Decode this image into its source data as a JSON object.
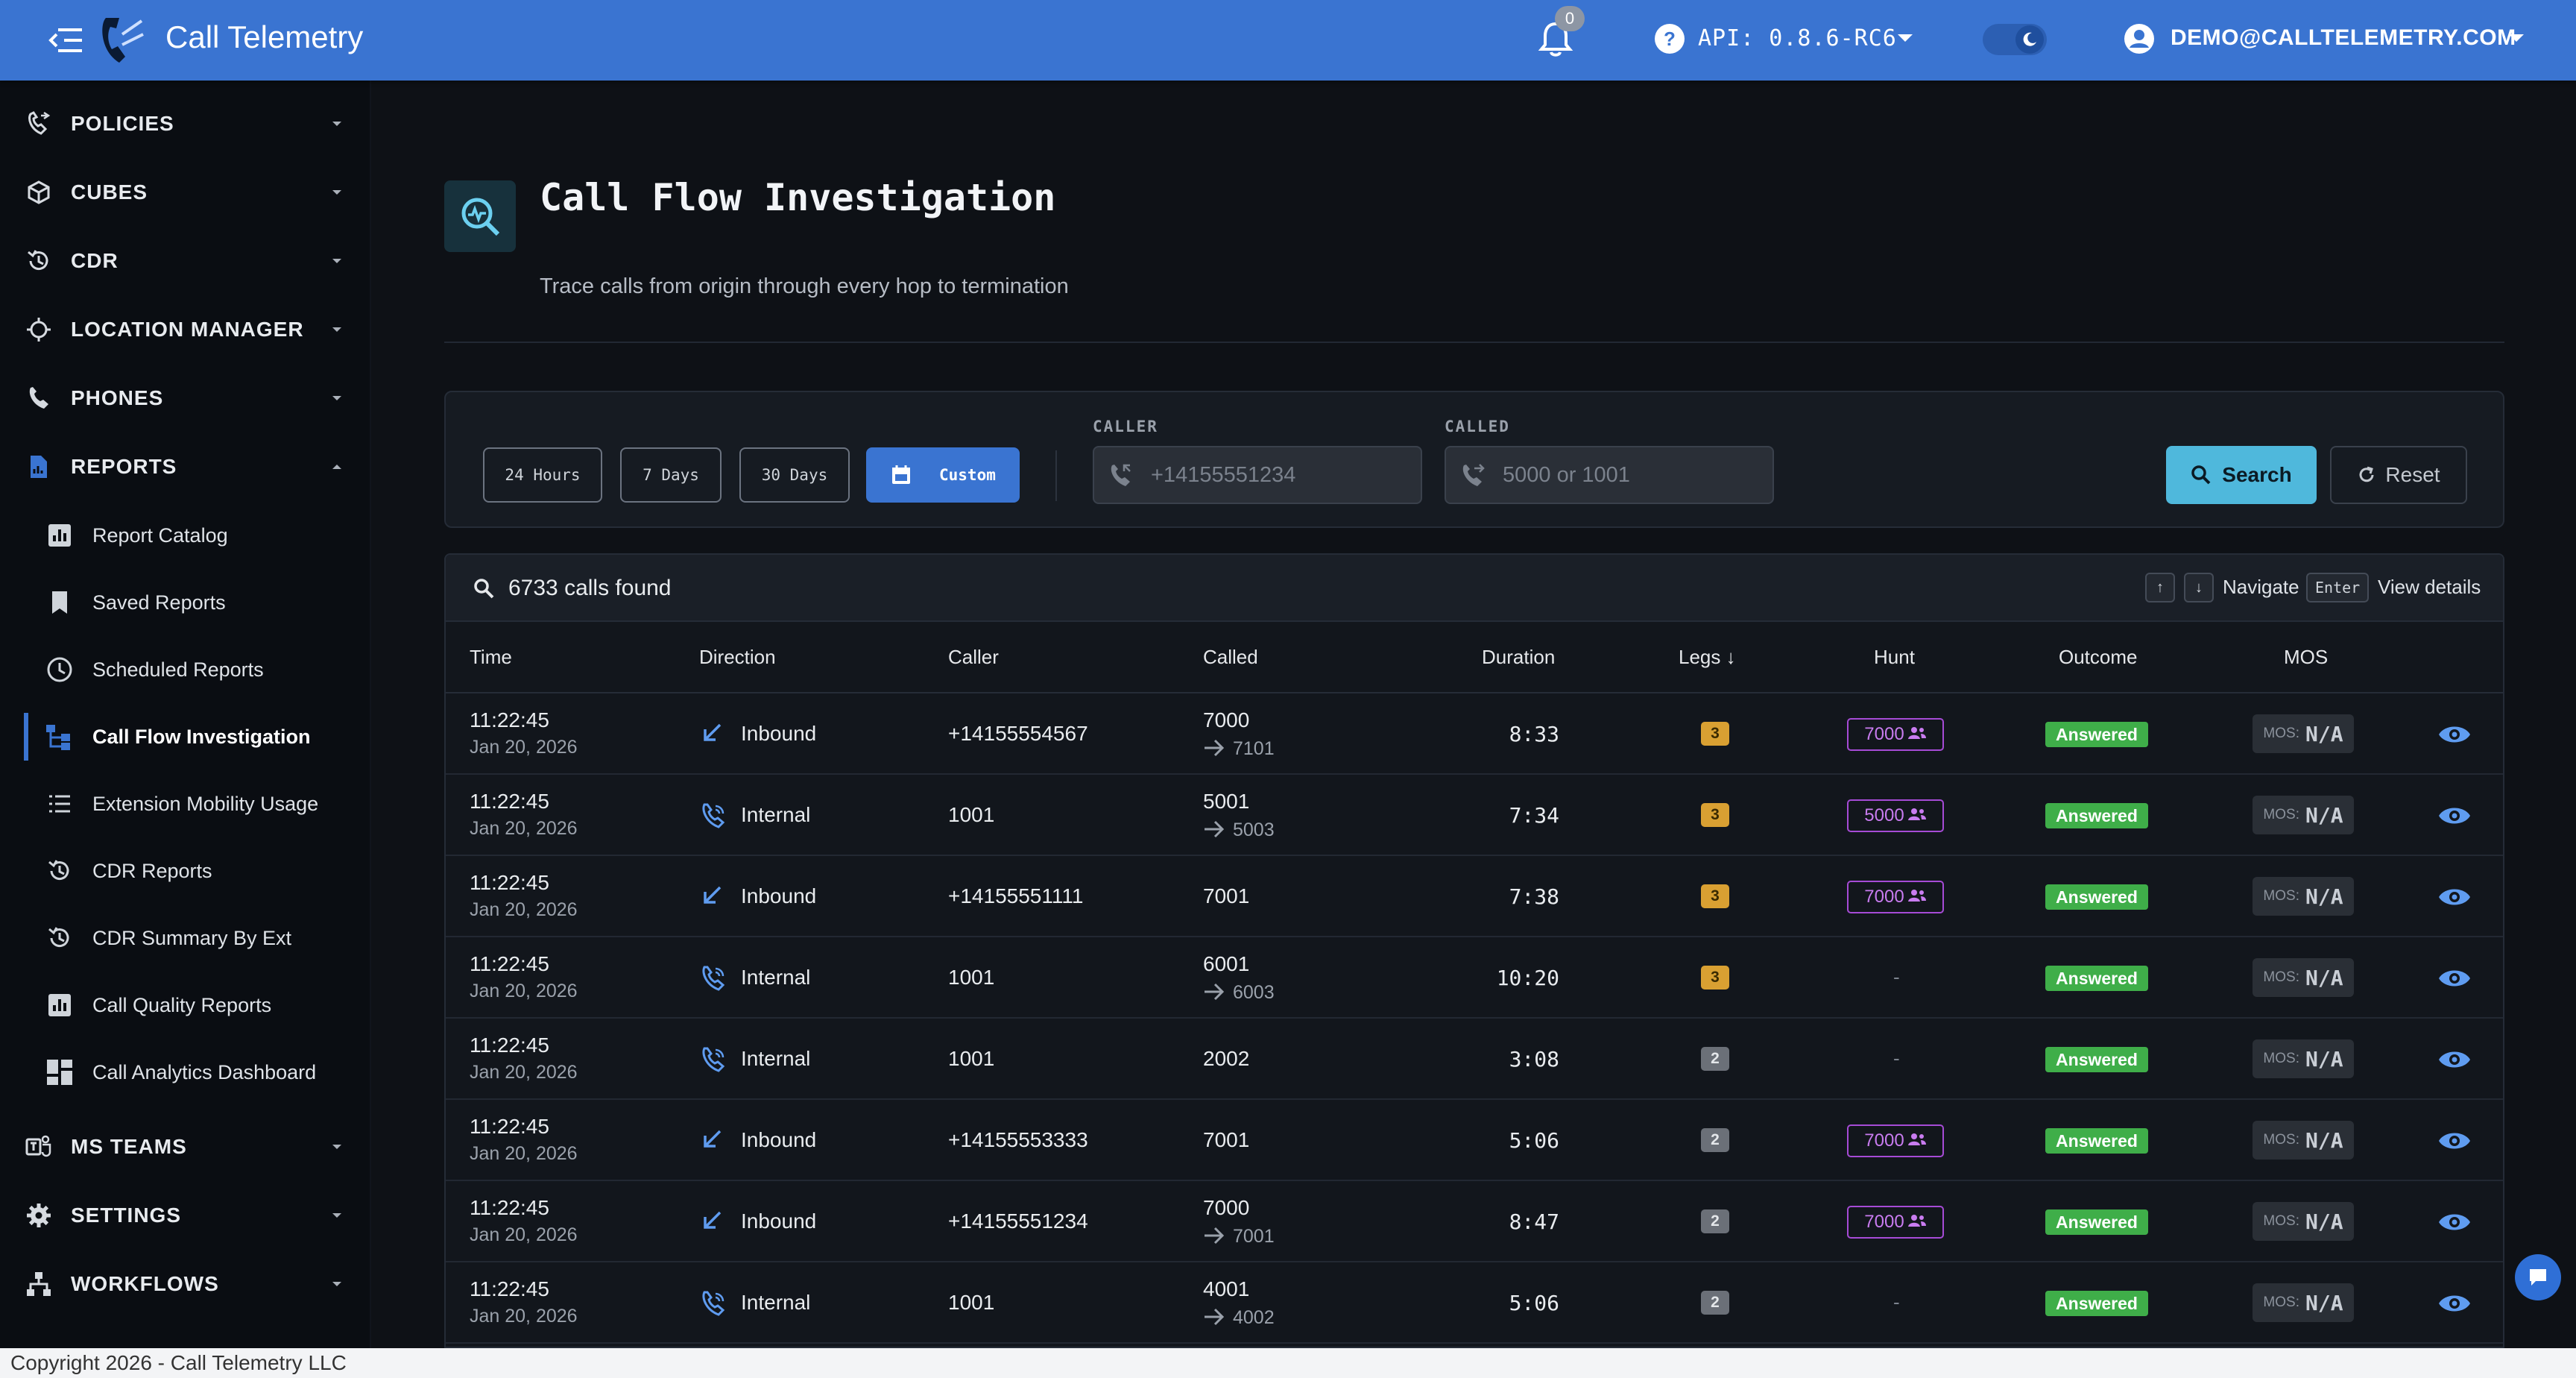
{
  "header": {
    "app_title": "Call Telemetry",
    "notification_count": "0",
    "api_label": "API: 0.8.6-RC6",
    "user_label": "DEMO@CALLTELEMETRY.COM",
    "icons": [
      "menu-toggle-icon",
      "phone-logo-icon",
      "bell-icon",
      "help-circle-icon",
      "chevron-down-icon",
      "moon-icon",
      "user-circle-icon"
    ]
  },
  "sidebar": {
    "sections": [
      {
        "label": "POLICIES",
        "icon": "phone-policy-icon"
      },
      {
        "label": "CUBES",
        "icon": "cube-icon"
      },
      {
        "label": "CDR",
        "icon": "history-icon"
      },
      {
        "label": "LOCATION MANAGER",
        "icon": "crosshair-icon"
      },
      {
        "label": "PHONES",
        "icon": "phone-icon"
      },
      {
        "label": "REPORTS",
        "icon": "report-file-icon"
      }
    ],
    "report_items": [
      {
        "label": "Report Catalog",
        "icon": "bar-chart-icon"
      },
      {
        "label": "Saved Reports",
        "icon": "bookmark-icon"
      },
      {
        "label": "Scheduled Reports",
        "icon": "clock-icon"
      },
      {
        "label": "Call Flow Investigation",
        "icon": "call-flow-icon"
      },
      {
        "label": "Extension Mobility Usage",
        "icon": "list-icon"
      },
      {
        "label": "CDR Reports",
        "icon": "history-icon"
      },
      {
        "label": "CDR Summary By Ext",
        "icon": "history-icon"
      },
      {
        "label": "Call Quality Reports",
        "icon": "bar-chart-icon"
      },
      {
        "label": "Call Analytics Dashboard",
        "icon": "dashboard-icon"
      }
    ],
    "lower_sections": [
      {
        "label": "MS TEAMS",
        "icon": "teams-icon"
      },
      {
        "label": "SETTINGS",
        "icon": "gear-icon"
      },
      {
        "label": "WORKFLOWS",
        "icon": "workflow-icon"
      }
    ]
  },
  "page": {
    "title": "Call Flow Investigation",
    "subtitle": "Trace calls from origin through every hop to termination",
    "icon": "trace-search-icon"
  },
  "filters": {
    "ranges": [
      "24 Hours",
      "7 Days",
      "30 Days",
      "Custom"
    ],
    "active_range": "Custom",
    "caller_label": "CALLER",
    "caller_placeholder": "+14155551234",
    "called_label": "CALLED",
    "called_placeholder": "5000 or 1001",
    "search_label": "Search",
    "reset_label": "Reset"
  },
  "results": {
    "count_label": "6733 calls found",
    "up_key": "↑",
    "down_key": "↓",
    "navigate_label": "Navigate",
    "enter_key": "Enter",
    "view_label": "View details",
    "columns": [
      "Time",
      "Direction",
      "Caller",
      "Called",
      "Duration",
      "Legs",
      "Hunt",
      "Outcome",
      "MOS"
    ],
    "sort_indicator": "↓",
    "mos_key": "MOS:",
    "rows": [
      {
        "time": "11:22:45",
        "date": "Jan 20, 2026",
        "direction": "Inbound",
        "caller": "+14155554567",
        "called": "7000",
        "called_to": "7101",
        "duration": "8:33",
        "legs": "3",
        "hunt": "7000",
        "outcome": "Answered",
        "mos": "N/A"
      },
      {
        "time": "11:22:45",
        "date": "Jan 20, 2026",
        "direction": "Internal",
        "caller": "1001",
        "called": "5001",
        "called_to": "5003",
        "duration": "7:34",
        "legs": "3",
        "hunt": "5000",
        "outcome": "Answered",
        "mos": "N/A"
      },
      {
        "time": "11:22:45",
        "date": "Jan 20, 2026",
        "direction": "Inbound",
        "caller": "+14155551111",
        "called": "7001",
        "called_to": "",
        "duration": "7:38",
        "legs": "3",
        "hunt": "7000",
        "outcome": "Answered",
        "mos": "N/A"
      },
      {
        "time": "11:22:45",
        "date": "Jan 20, 2026",
        "direction": "Internal",
        "caller": "1001",
        "called": "6001",
        "called_to": "6003",
        "duration": "10:20",
        "legs": "3",
        "hunt": "-",
        "outcome": "Answered",
        "mos": "N/A"
      },
      {
        "time": "11:22:45",
        "date": "Jan 20, 2026",
        "direction": "Internal",
        "caller": "1001",
        "called": "2002",
        "called_to": "",
        "duration": "3:08",
        "legs": "2",
        "hunt": "-",
        "outcome": "Answered",
        "mos": "N/A"
      },
      {
        "time": "11:22:45",
        "date": "Jan 20, 2026",
        "direction": "Inbound",
        "caller": "+14155553333",
        "called": "7001",
        "called_to": "",
        "duration": "5:06",
        "legs": "2",
        "hunt": "7000",
        "outcome": "Answered",
        "mos": "N/A"
      },
      {
        "time": "11:22:45",
        "date": "Jan 20, 2026",
        "direction": "Inbound",
        "caller": "+14155551234",
        "called": "7000",
        "called_to": "7001",
        "duration": "8:47",
        "legs": "2",
        "hunt": "7000",
        "outcome": "Answered",
        "mos": "N/A"
      },
      {
        "time": "11:22:45",
        "date": "Jan 20, 2026",
        "direction": "Internal",
        "caller": "1001",
        "called": "4001",
        "called_to": "4002",
        "duration": "5:06",
        "legs": "2",
        "hunt": "-",
        "outcome": "Answered",
        "mos": "N/A"
      }
    ]
  },
  "footer": {
    "text": "Copyright 2026 - Call Telemetry LLC"
  },
  "colors": {
    "topbar": "#3a74d1",
    "accent": "#3a74d1",
    "search": "#4fb8dc",
    "answered": "#3fae49",
    "hunt": "#a64bd6",
    "legs3": "#d9a032",
    "legs2": "#6b7078"
  }
}
